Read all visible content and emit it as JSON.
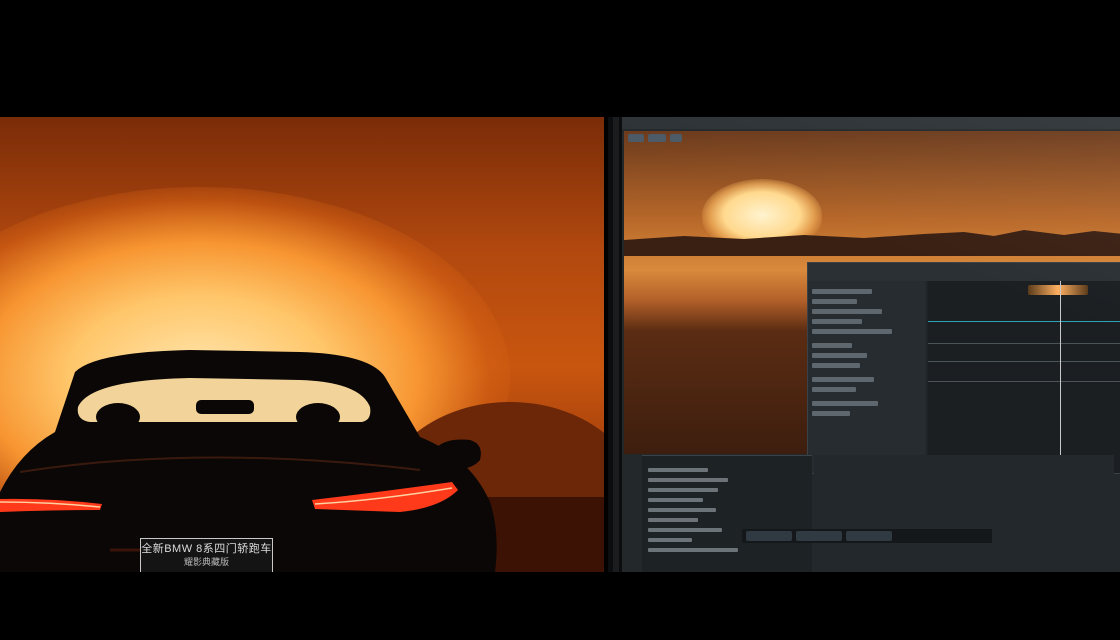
{
  "plate": {
    "line1": "全新BMW 8系四门轿跑车",
    "line2": "耀影典藏版"
  },
  "colors": {
    "sunset_orange": "#c8560f",
    "sun_core": "#ffe7b0",
    "taillight_red": "#ff3a1a",
    "editor_panel": "#23282b"
  }
}
